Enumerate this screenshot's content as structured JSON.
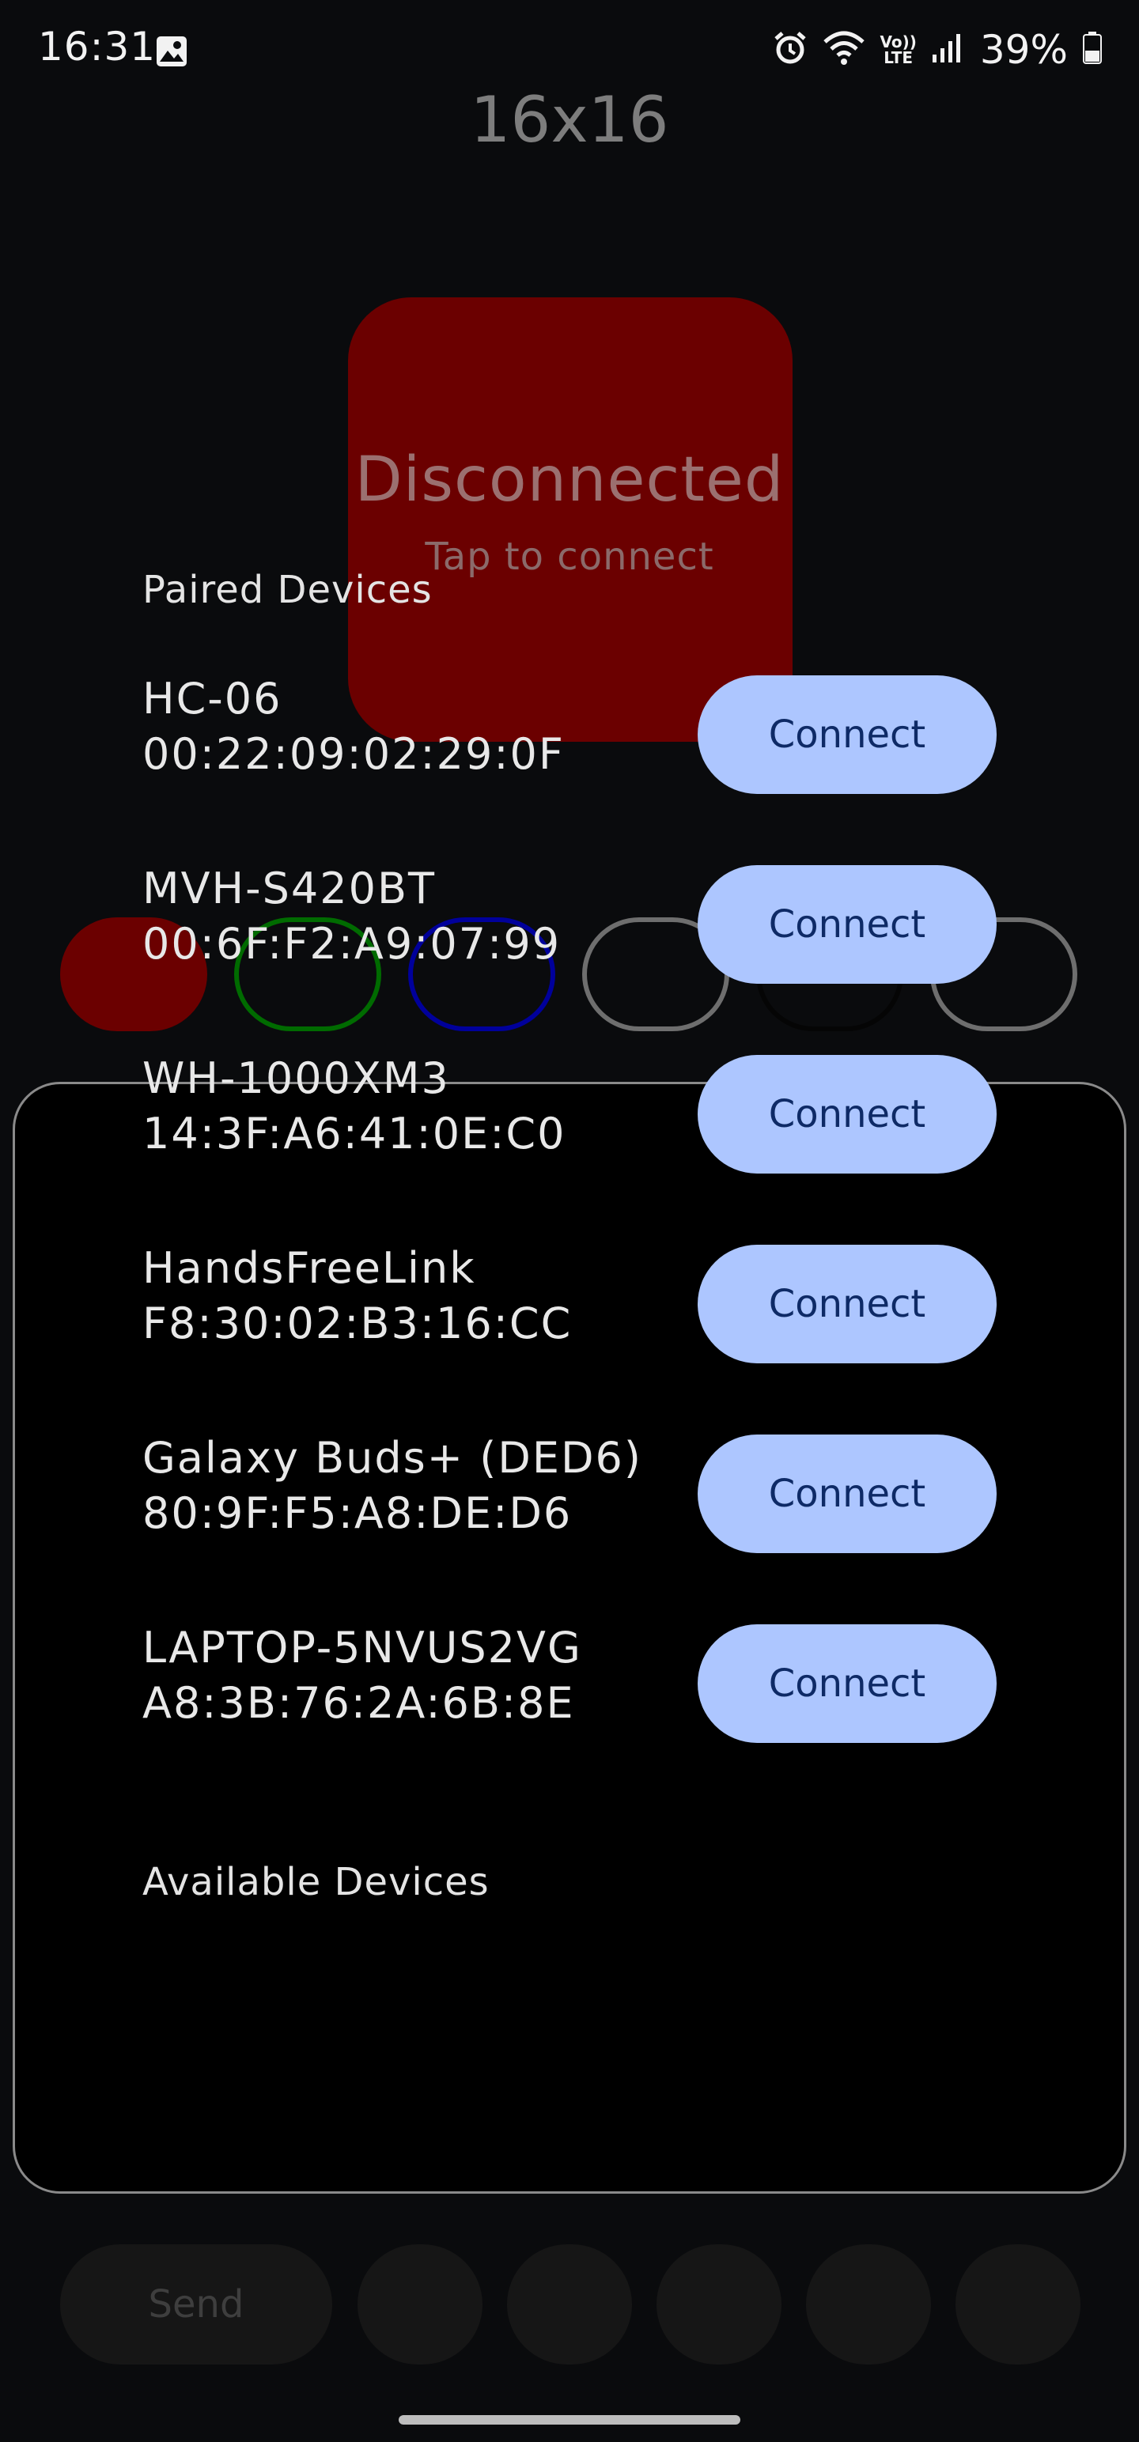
{
  "status_bar": {
    "time": "16:31",
    "left_icons": [
      "gallery-icon"
    ],
    "right_icons": [
      "alarm-icon",
      "wifi-icon",
      "volte-icon",
      "signal-icon",
      "battery-icon"
    ],
    "volte_label_top": "Vo))",
    "volte_label_bottom": "LTE",
    "battery_percent": "39%"
  },
  "app": {
    "title": "16x16"
  },
  "connection": {
    "status": "Disconnected",
    "hint": "Tap to connect",
    "tile_color": "#6b0000"
  },
  "swatches": [
    {
      "name": "red",
      "color": "#6b0000",
      "style": "filled"
    },
    {
      "name": "green",
      "color": "#006b00",
      "style": "outline"
    },
    {
      "name": "blue",
      "color": "#00009b",
      "style": "outline"
    },
    {
      "name": "gray",
      "color": "#6e6e6e",
      "style": "outline"
    },
    {
      "name": "black",
      "color": "#050505",
      "style": "outline"
    },
    {
      "name": "gray",
      "color": "#6e6e6e",
      "style": "outline"
    }
  ],
  "dialog": {
    "paired_header": "Paired Devices",
    "available_header": "Available Devices",
    "paired_devices": [
      {
        "name": "HC-06",
        "address": "00:22:09:02:29:0F",
        "button": "Connect"
      },
      {
        "name": "MVH-S420BT",
        "address": "00:6F:F2:A9:07:99",
        "button": "Connect"
      },
      {
        "name": "WH-1000XM3",
        "address": "14:3F:A6:41:0E:C0",
        "button": "Connect"
      },
      {
        "name": "HandsFreeLink",
        "address": "F8:30:02:B3:16:CC",
        "button": "Connect"
      },
      {
        "name": "Galaxy Buds+ (DED6)",
        "address": "80:9F:F5:A8:DE:D6",
        "button": "Connect"
      },
      {
        "name": "LAPTOP-5NVUS2VG",
        "address": "A8:3B:76:2A:6B:8E",
        "button": "Connect"
      }
    ],
    "button_color": "#adc6ff",
    "button_text_color": "#0e2a66"
  },
  "bottom_bar": {
    "send_label": "Send"
  }
}
